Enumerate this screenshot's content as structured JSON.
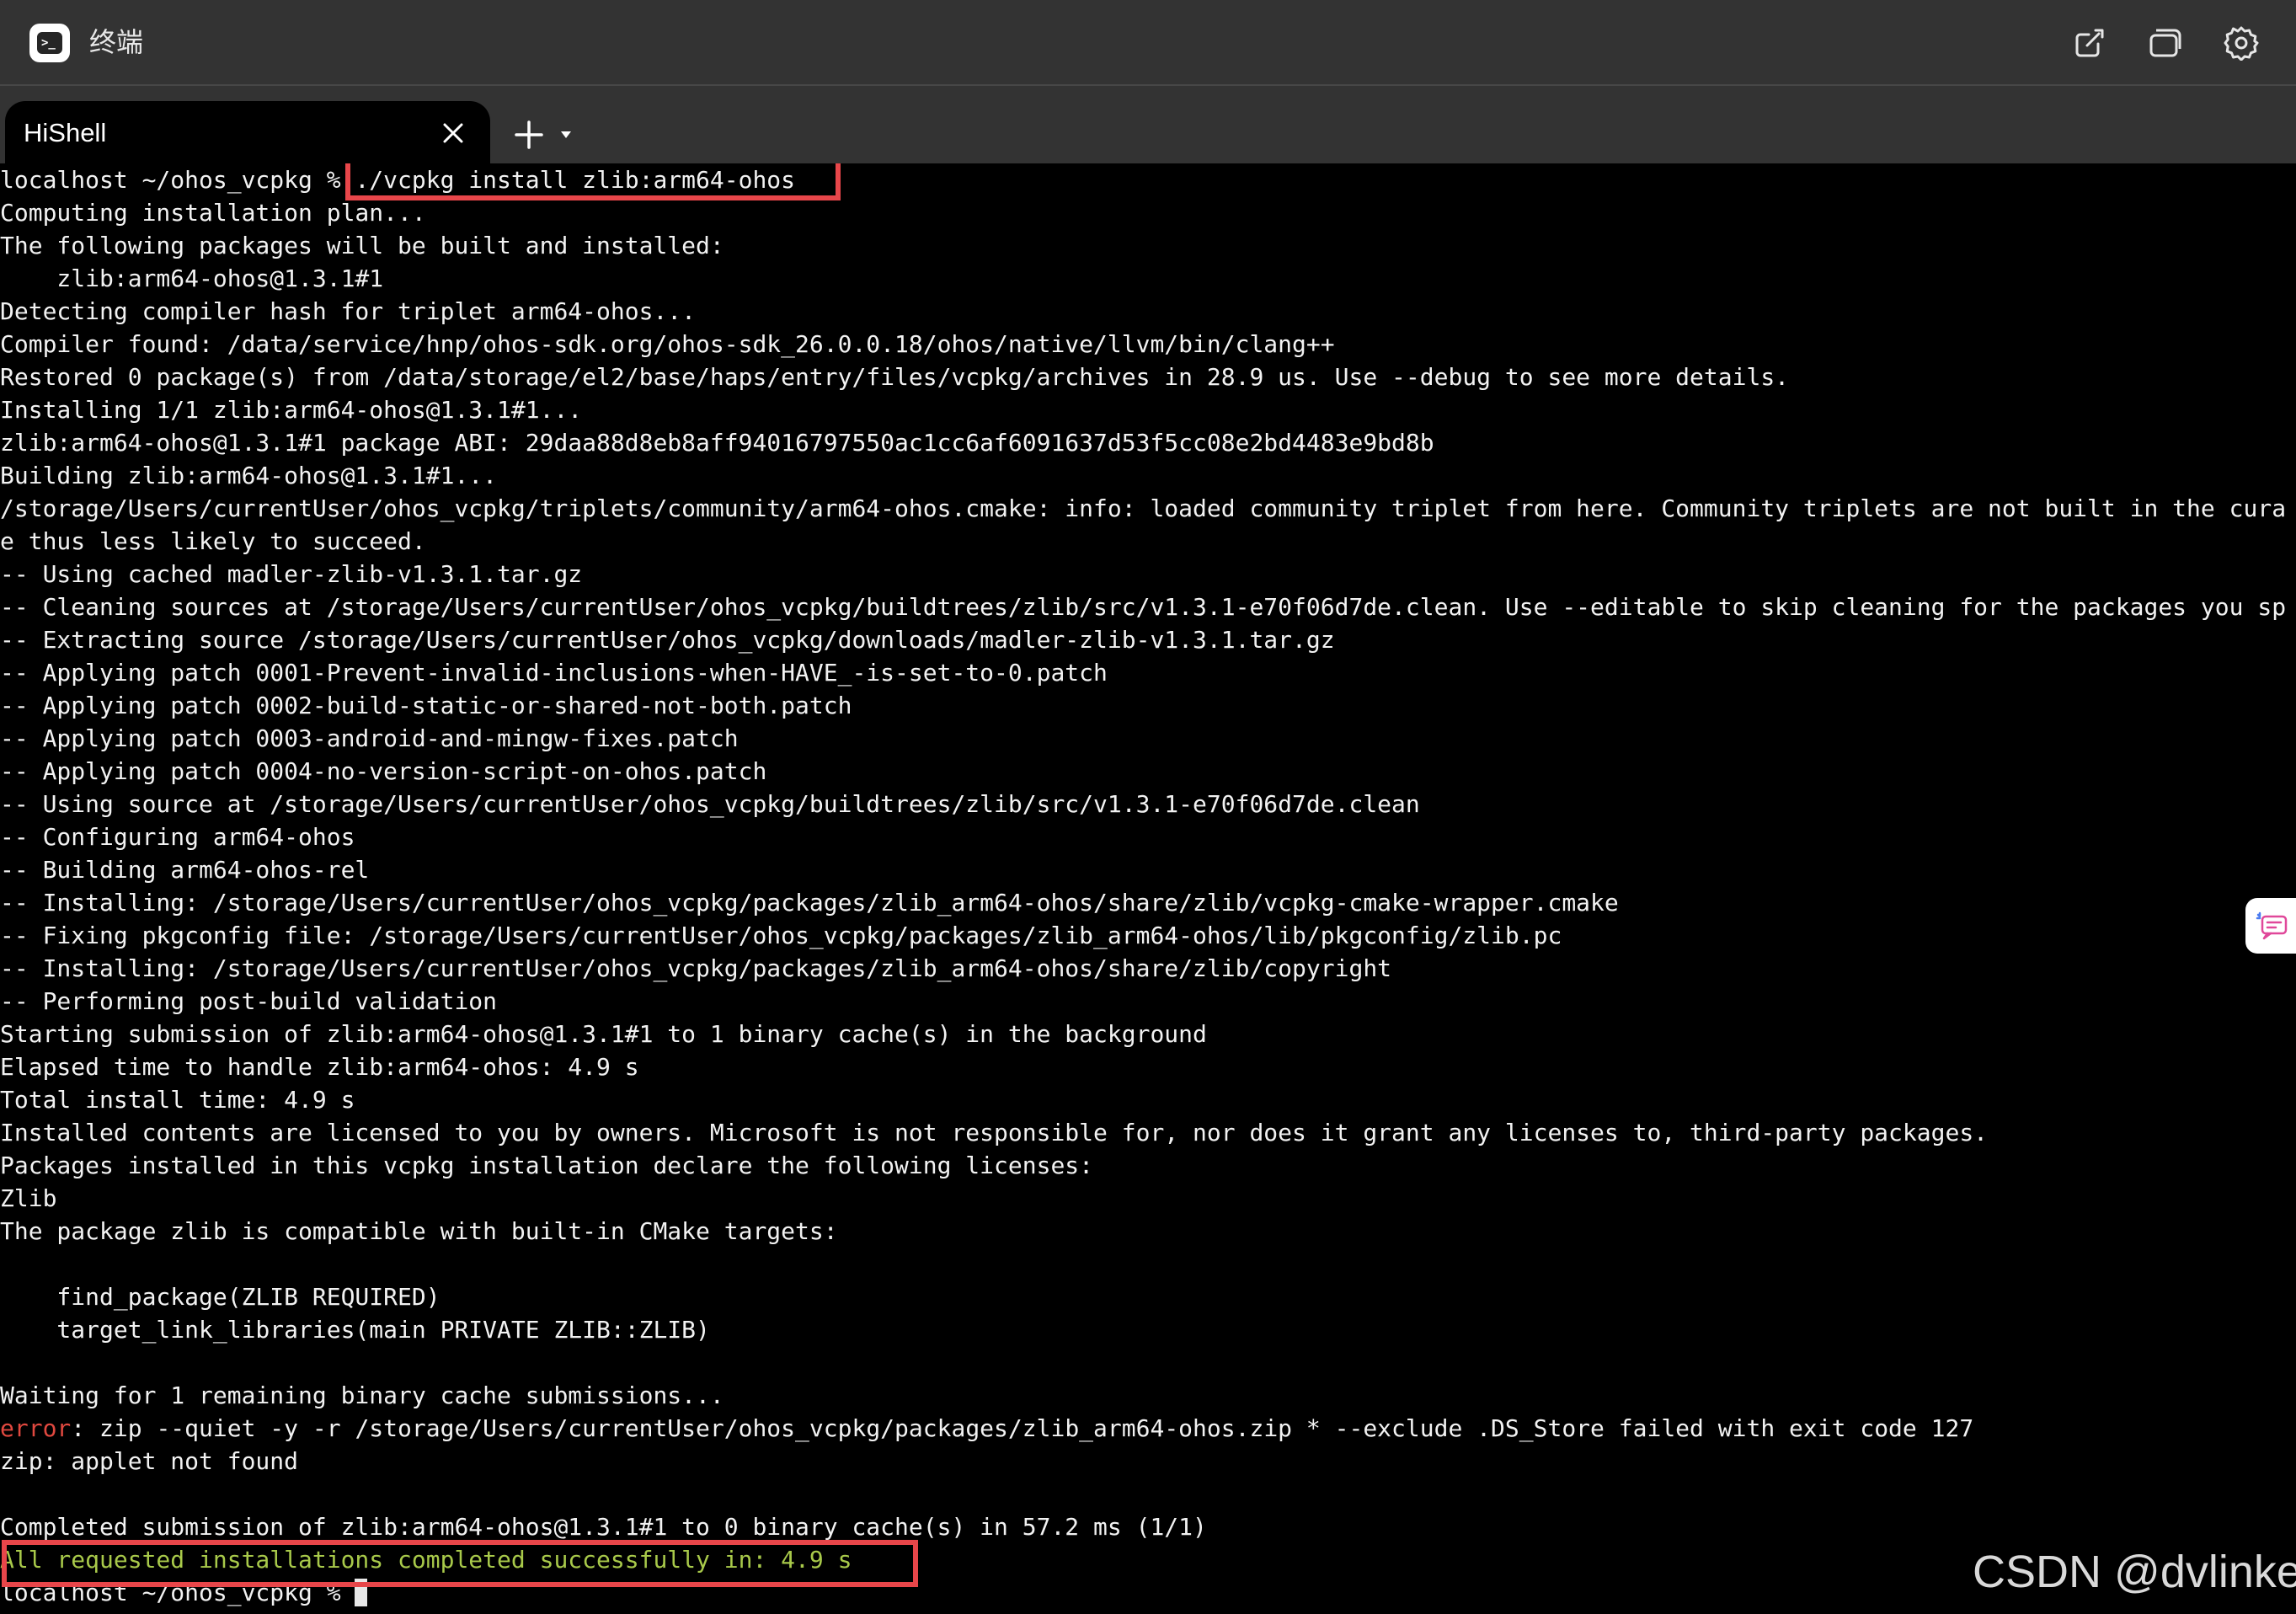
{
  "window": {
    "title": "终端",
    "actions": [
      {
        "name": "new-window",
        "icon": "edit-square-icon"
      },
      {
        "name": "window-switch",
        "icon": "overlapping-windows-icon"
      },
      {
        "name": "settings",
        "icon": "gear-icon"
      }
    ]
  },
  "tabs": [
    {
      "label": "HiShell",
      "active": true
    }
  ],
  "tab_actions": {
    "new_tab_icon": "plus-icon",
    "menu_icon": "caret-down-icon"
  },
  "terminal": {
    "prompt": "localhost ~/ohos_vcpkg % ",
    "command": "./vcpkg install zlib:arm64-ohos",
    "lines": [
      "Computing installation plan...",
      "The following packages will be built and installed:",
      "    zlib:arm64-ohos@1.3.1#1",
      "Detecting compiler hash for triplet arm64-ohos...",
      "Compiler found: /data/service/hnp/ohos-sdk.org/ohos-sdk_26.0.0.18/ohos/native/llvm/bin/clang++",
      "Restored 0 package(s) from /data/storage/el2/base/haps/entry/files/vcpkg/archives in 28.9 us. Use --debug to see more details.",
      "Installing 1/1 zlib:arm64-ohos@1.3.1#1...",
      "zlib:arm64-ohos@1.3.1#1 package ABI: 29daa88d8eb8aff94016797550ac1cc6af6091637d53f5cc08e2bd4483e9bd8b",
      "Building zlib:arm64-ohos@1.3.1#1...",
      "/storage/Users/currentUser/ohos_vcpkg/triplets/community/arm64-ohos.cmake: info: loaded community triplet from here. Community triplets are not built in the cura",
      "e thus less likely to succeed.",
      "-- Using cached madler-zlib-v1.3.1.tar.gz",
      "-- Cleaning sources at /storage/Users/currentUser/ohos_vcpkg/buildtrees/zlib/src/v1.3.1-e70f06d7de.clean. Use --editable to skip cleaning for the packages you sp",
      "-- Extracting source /storage/Users/currentUser/ohos_vcpkg/downloads/madler-zlib-v1.3.1.tar.gz",
      "-- Applying patch 0001-Prevent-invalid-inclusions-when-HAVE_-is-set-to-0.patch",
      "-- Applying patch 0002-build-static-or-shared-not-both.patch",
      "-- Applying patch 0003-android-and-mingw-fixes.patch",
      "-- Applying patch 0004-no-version-script-on-ohos.patch",
      "-- Using source at /storage/Users/currentUser/ohos_vcpkg/buildtrees/zlib/src/v1.3.1-e70f06d7de.clean",
      "-- Configuring arm64-ohos",
      "-- Building arm64-ohos-rel",
      "-- Installing: /storage/Users/currentUser/ohos_vcpkg/packages/zlib_arm64-ohos/share/zlib/vcpkg-cmake-wrapper.cmake",
      "-- Fixing pkgconfig file: /storage/Users/currentUser/ohos_vcpkg/packages/zlib_arm64-ohos/lib/pkgconfig/zlib.pc",
      "-- Installing: /storage/Users/currentUser/ohos_vcpkg/packages/zlib_arm64-ohos/share/zlib/copyright",
      "-- Performing post-build validation",
      "Starting submission of zlib:arm64-ohos@1.3.1#1 to 1 binary cache(s) in the background",
      "Elapsed time to handle zlib:arm64-ohos: 4.9 s",
      "Total install time: 4.9 s",
      "Installed contents are licensed to you by owners. Microsoft is not responsible for, nor does it grant any licenses to, third-party packages.",
      "Packages installed in this vcpkg installation declare the following licenses:",
      "Zlib",
      "The package zlib is compatible with built-in CMake targets:",
      "",
      "    find_package(ZLIB REQUIRED)",
      "    target_link_libraries(main PRIVATE ZLIB::ZLIB)",
      "",
      "Waiting for 1 remaining binary cache submissions..."
    ],
    "error_label": "error",
    "error_rest": ": zip --quiet -y -r /storage/Users/currentUser/ohos_vcpkg/packages/zlib_arm64-ohos.zip * --exclude .DS_Store failed with exit code 127",
    "lines_after_error": [
      "zip: applet not found",
      "",
      "Completed submission of zlib:arm64-ohos@1.3.1#1 to 0 binary cache(s) in 57.2 ms (1/1)"
    ],
    "success_line": "All requested installations completed successfully in: 4.9 s",
    "final_prompt": "localhost ~/ohos_vcpkg % "
  },
  "side_widget": {
    "icon": "ai-assistant-icon"
  },
  "watermark": "CSDN @dvlinker",
  "colors": {
    "chrome": "#333333",
    "terminal_bg": "#000000",
    "text": "#f2f2f2",
    "error": "#e0483f",
    "success": "#a8c94a",
    "highlight": "#e8464a"
  }
}
